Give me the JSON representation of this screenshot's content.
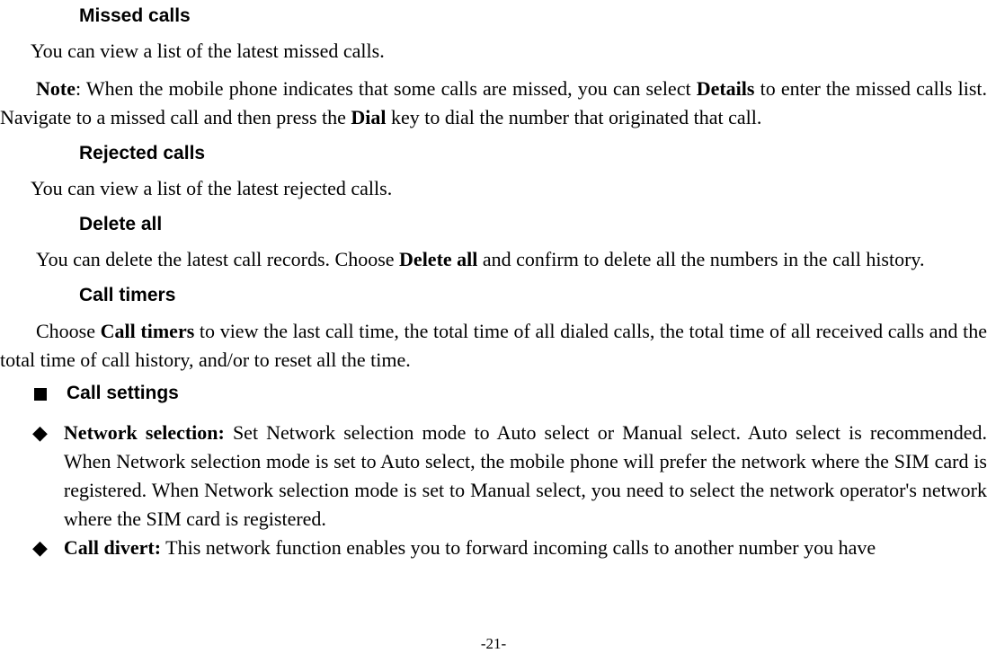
{
  "sections": {
    "missed_calls": {
      "heading": "Missed calls",
      "body": "You can view a list of the latest missed calls.",
      "note_label": "Note",
      "note_part1": ": When the mobile phone indicates that some calls are missed, you can select ",
      "note_bold1": "Details",
      "note_part2": " to enter the missed calls list. Navigate to a missed call and then press the ",
      "note_bold2": "Dial",
      "note_part3": " key to dial the number that originated that call."
    },
    "rejected_calls": {
      "heading": "Rejected calls",
      "body": "You can view a list of the latest rejected calls."
    },
    "delete_all": {
      "heading": "Delete all",
      "body_part1": "You can delete the latest call records. Choose ",
      "body_bold": "Delete all",
      "body_part2": " and confirm to delete all the numbers in the call history."
    },
    "call_timers": {
      "heading": "Call timers",
      "body_part1": "Choose ",
      "body_bold": "Call timers",
      "body_part2": " to view the last call time, the total time of all dialed calls, the total time of all received calls and the total time of call history, and/or to reset all the time."
    },
    "call_settings": {
      "heading": "Call settings",
      "network_sel_label": "Network selection:",
      "network_sel_body": " Set Network selection mode to Auto select or Manual select. Auto select is recommended. When Network selection mode is set to Auto select, the mobile phone will prefer the network where the SIM card is registered. When Network selection mode is set to Manual select, you need to select the network operator's network where the SIM card is registered.",
      "call_divert_label": "Call divert:",
      "call_divert_body": " This network function enables you to forward incoming calls to another number you have"
    }
  },
  "page_number": "-21-"
}
